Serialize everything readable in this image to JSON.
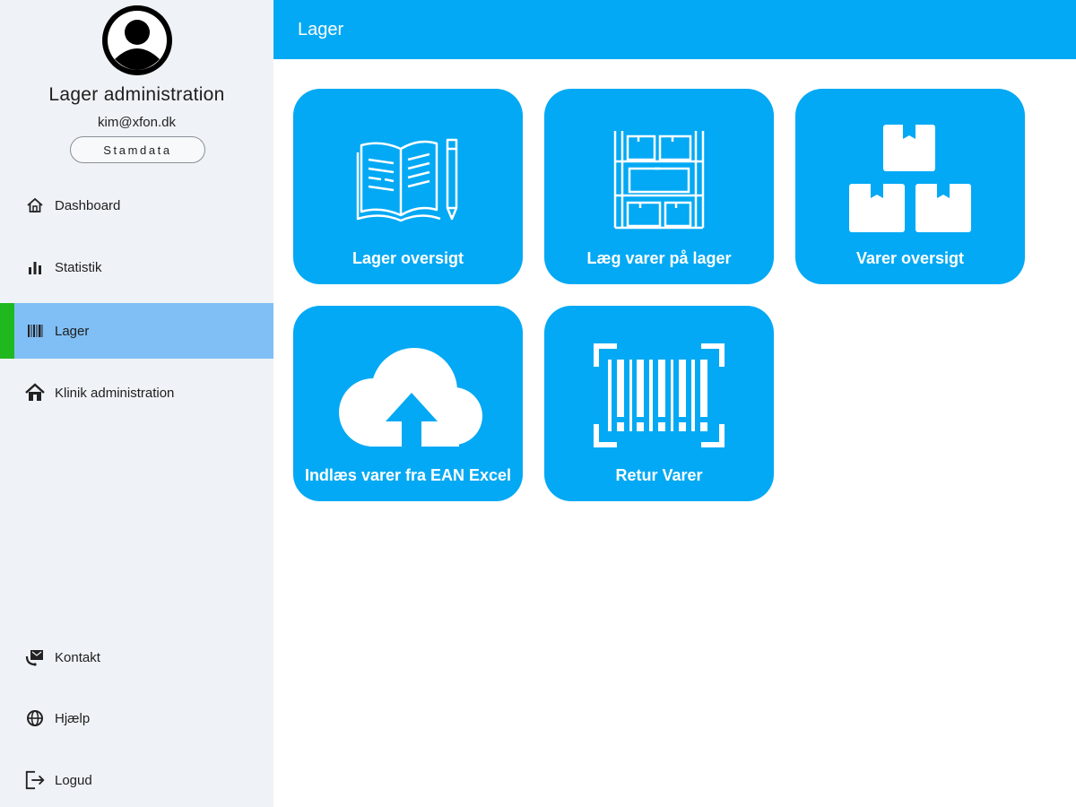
{
  "sidebar": {
    "title": "Lager administration",
    "email": "kim@xfon.dk",
    "stamdata_label": "Stamdata",
    "nav": [
      {
        "label": "Dashboard",
        "icon": "home-icon"
      },
      {
        "label": "Statistik",
        "icon": "bar-chart-icon"
      },
      {
        "label": "Lager",
        "icon": "barcode-icon",
        "active": true
      },
      {
        "label": "Klinik administration",
        "icon": "house-icon"
      }
    ],
    "bottom_nav": [
      {
        "label": "Kontakt",
        "icon": "contact-icon"
      },
      {
        "label": "Hjælp",
        "icon": "globe-icon"
      },
      {
        "label": "Logud",
        "icon": "logout-icon"
      }
    ]
  },
  "header": {
    "title": "Lager"
  },
  "tiles": [
    {
      "label": "Lager oversigt",
      "icon": "book-pencil-icon"
    },
    {
      "label": "Læg varer på lager",
      "icon": "shelf-boxes-icon"
    },
    {
      "label": "Varer oversigt",
      "icon": "stacked-boxes-icon"
    },
    {
      "label": "Indlæs varer fra EAN Excel",
      "icon": "cloud-upload-icon"
    },
    {
      "label": "Retur Varer",
      "icon": "barcode-scan-icon"
    }
  ],
  "colors": {
    "accent": "#03a9f4",
    "active_nav": "#80bff5",
    "active_marker": "#1fb81f",
    "sidebar_bg": "#eff3f7"
  }
}
